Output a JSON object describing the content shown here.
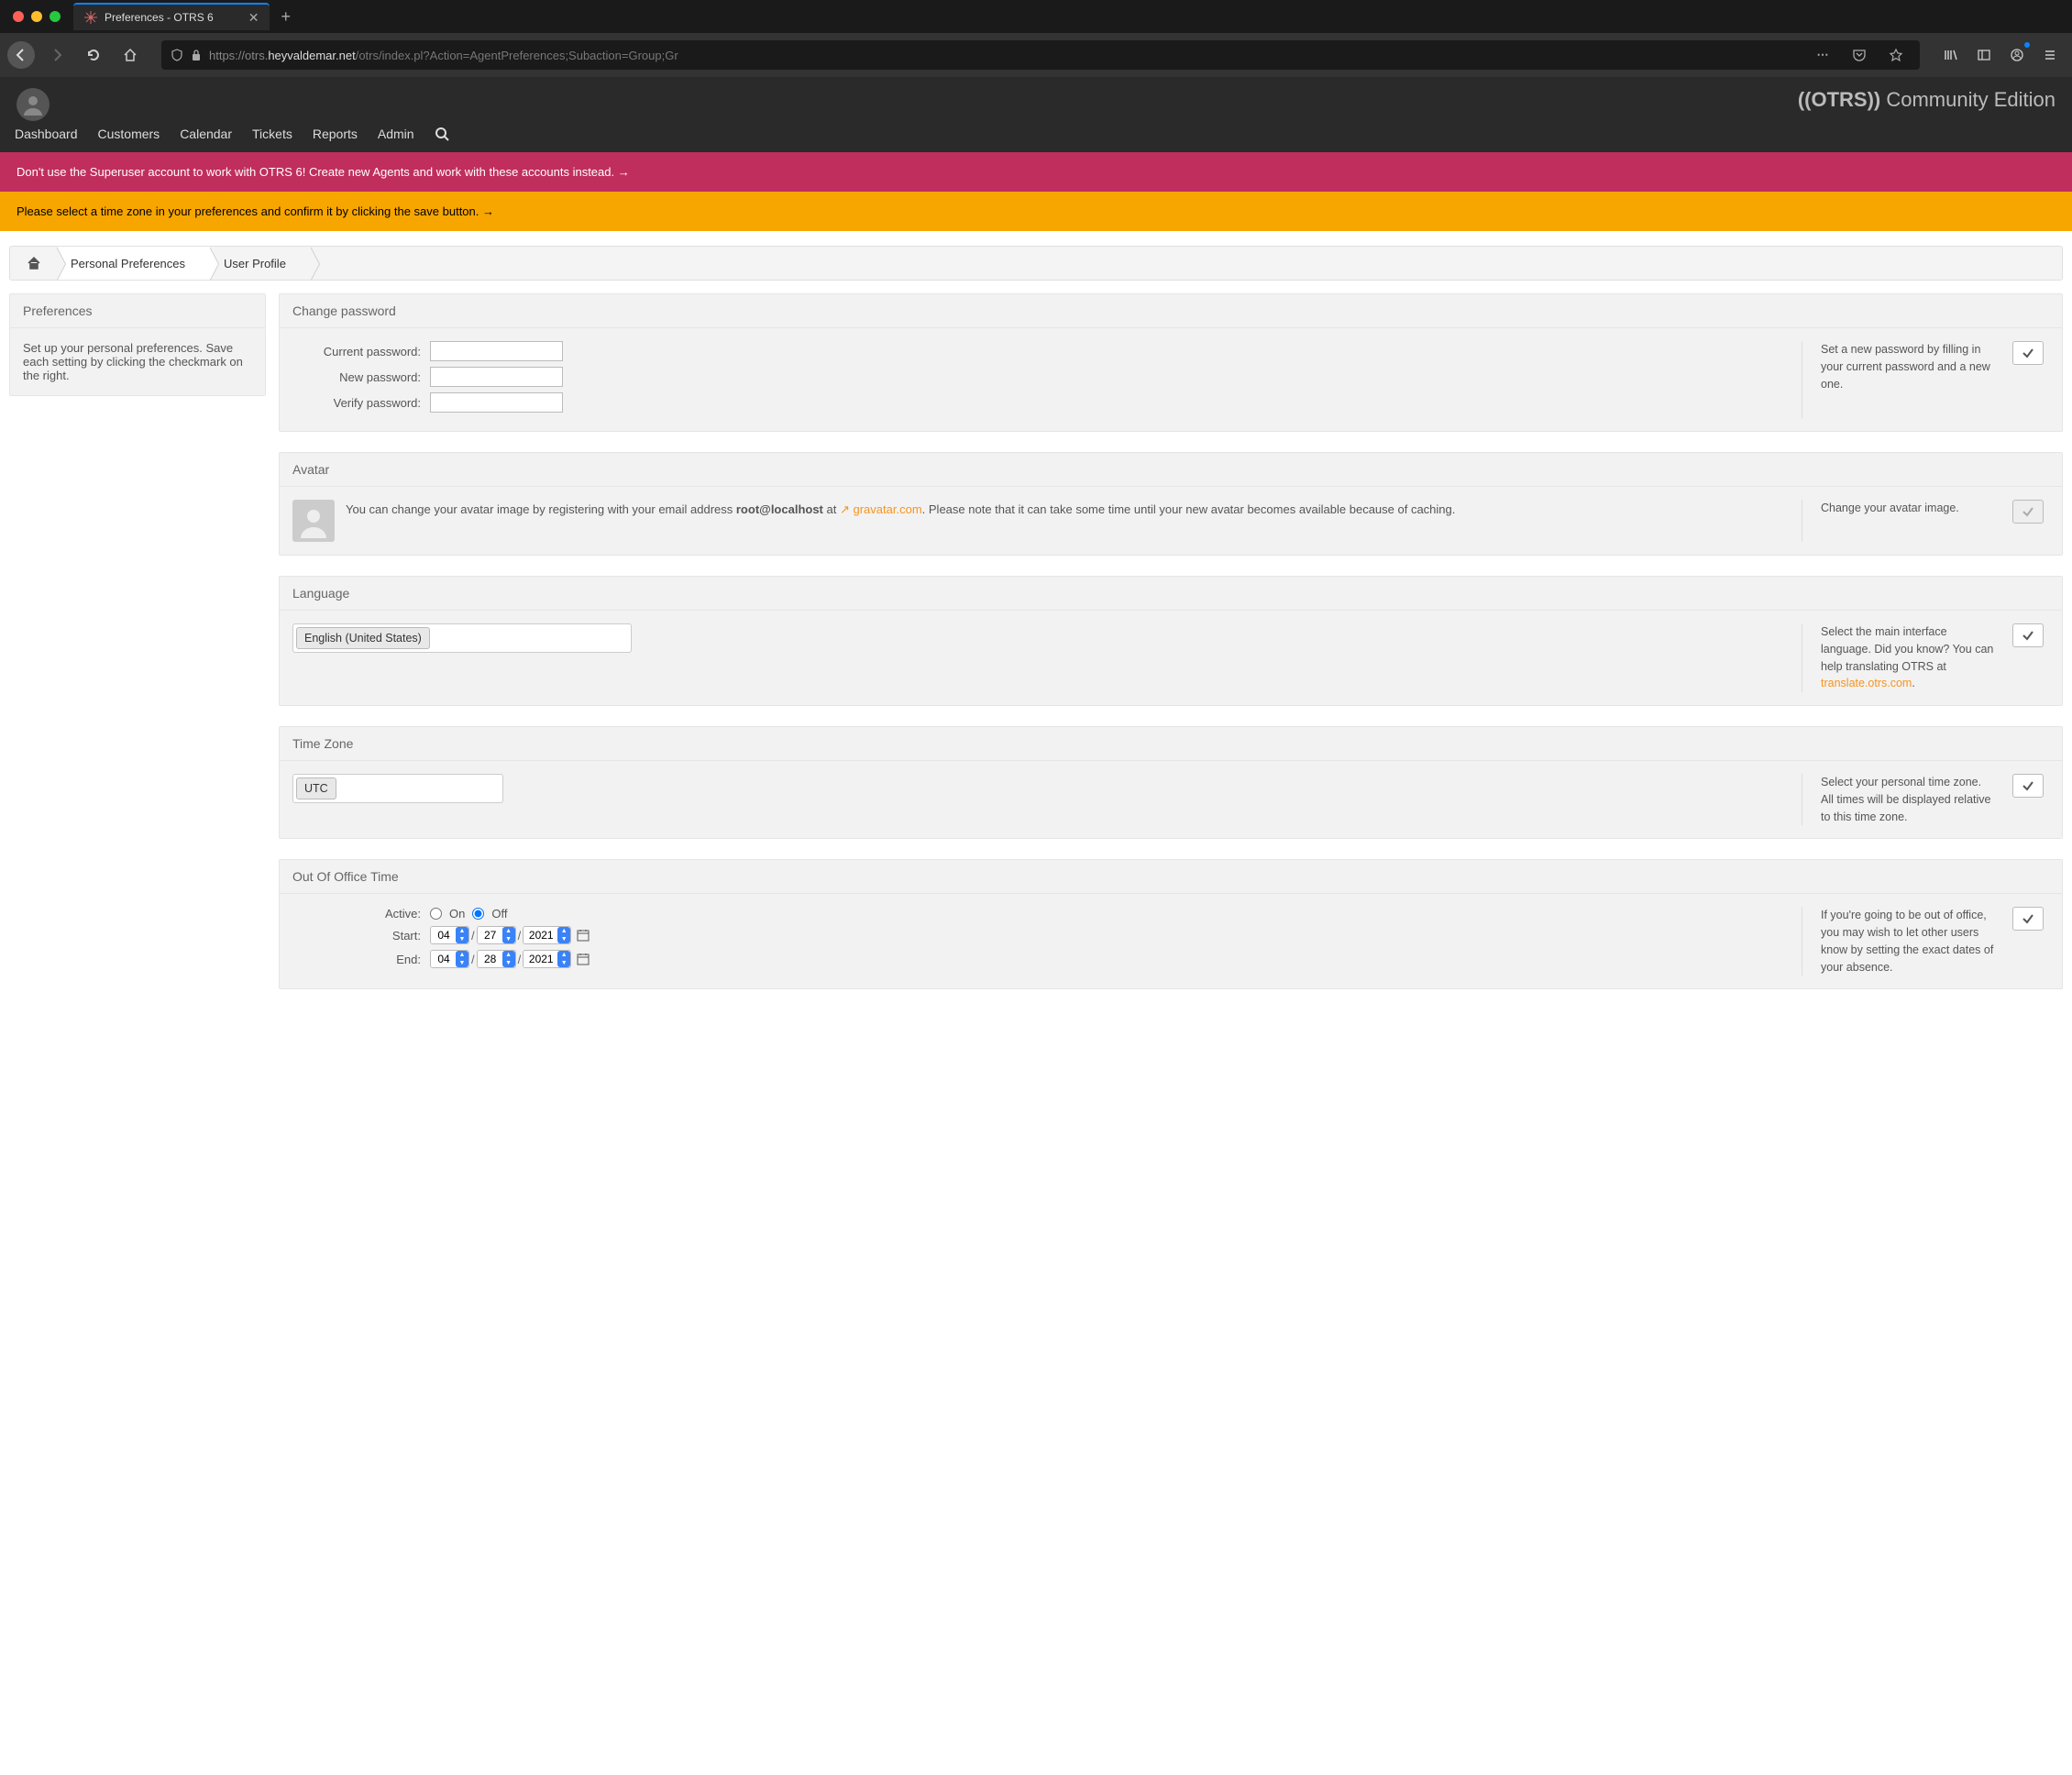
{
  "browser": {
    "tab_title": "Preferences - OTRS 6",
    "url_prefix": "https://otrs.",
    "url_host": "heyvaldemar.net",
    "url_path": "/otrs/index.pl?Action=AgentPreferences;Subaction=Group;Gr"
  },
  "header": {
    "brand_strong": "((OTRS))",
    "brand_rest": " Community Edition",
    "nav": [
      "Dashboard",
      "Customers",
      "Calendar",
      "Tickets",
      "Reports",
      "Admin"
    ]
  },
  "banners": {
    "red": "Don't use the Superuser account to work with OTRS 6! Create new Agents and work with these accounts instead. →",
    "amber": "Please select a time zone in your preferences and confirm it by clicking the save button. →"
  },
  "breadcrumb": {
    "mid": "Personal Preferences",
    "last": "User Profile"
  },
  "sidebar": {
    "title": "Preferences",
    "body": "Set up your personal preferences. Save each setting by clicking the checkmark on the right."
  },
  "sections": {
    "password": {
      "title": "Change password",
      "labels": {
        "current": "Current password:",
        "new": "New password:",
        "verify": "Verify password:"
      },
      "help": "Set a new password by filling in your current password and a new one."
    },
    "avatar": {
      "title": "Avatar",
      "text_a": "You can change your avatar image by registering with your email address ",
      "email": "root@localhost",
      "text_b": " at ",
      "link": "gravatar.com",
      "text_c": ". Please note that it can take some time until your new avatar becomes available because of caching.",
      "help": "Change your avatar image."
    },
    "language": {
      "title": "Language",
      "value": "English (United States)",
      "help_a": "Select the main interface language. Did you know? You can help translating OTRS at ",
      "help_link": "translate.otrs.com",
      "help_b": "."
    },
    "timezone": {
      "title": "Time Zone",
      "value": "UTC",
      "help": "Select your personal time zone. All times will be displayed relative to this time zone."
    },
    "ooo": {
      "title": "Out Of Office Time",
      "labels": {
        "active": "Active:",
        "start": "Start:",
        "end": "End:",
        "on": "On",
        "off": "Off"
      },
      "start": {
        "m": "04",
        "d": "27",
        "y": "2021"
      },
      "end": {
        "m": "04",
        "d": "28",
        "y": "2021"
      },
      "help": "If you're going to be out of office, you may wish to let other users know by setting the exact dates of your absence."
    }
  }
}
